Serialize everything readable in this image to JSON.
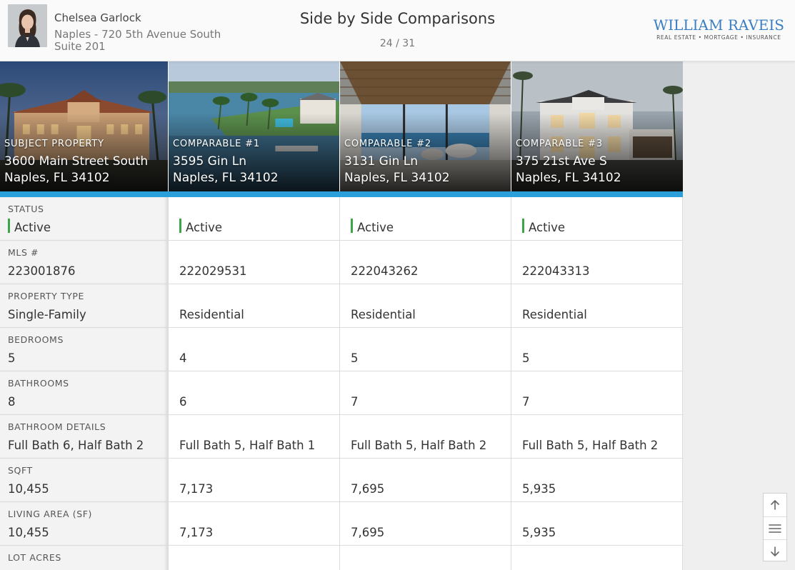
{
  "agent": {
    "name": "Chelsea Garlock",
    "office_line1": "Naples - 720 5th Avenue South",
    "office_line2": "Suite 201"
  },
  "page": {
    "title": "Side by Side Comparisons",
    "pager": "24 / 31"
  },
  "logo": {
    "main": "WILLIAM RAVEIS",
    "sub": "REAL ESTATE • MORTGAGE • INSURANCE"
  },
  "properties": [
    {
      "caption": "SUBJECT PROPERTY",
      "address_line1": "3600 Main Street South",
      "address_line2": "Naples, FL 34102"
    },
    {
      "caption": "COMPARABLE #1",
      "address_line1": "3595 Gin Ln",
      "address_line2": "Naples, FL 34102"
    },
    {
      "caption": "COMPARABLE #2",
      "address_line1": "3131 Gin Ln",
      "address_line2": "Naples, FL 34102"
    },
    {
      "caption": "COMPARABLE #3",
      "address_line1": "375 21st Ave S",
      "address_line2": "Naples, FL 34102"
    }
  ],
  "rows": [
    {
      "label": "STATUS",
      "values": [
        "Active",
        "Active",
        "Active",
        "Active"
      ]
    },
    {
      "label": "MLS #",
      "values": [
        "223001876",
        "222029531",
        "222043262",
        "222043313"
      ]
    },
    {
      "label": "PROPERTY TYPE",
      "values": [
        "Single-Family",
        "Residential",
        "Residential",
        "Residential"
      ]
    },
    {
      "label": "BEDROOMS",
      "values": [
        "5",
        "4",
        "5",
        "5"
      ]
    },
    {
      "label": "BATHROOMS",
      "values": [
        "8",
        "6",
        "7",
        "7"
      ]
    },
    {
      "label": "BATHROOM DETAILS",
      "values": [
        "Full Bath 6, Half Bath 2",
        "Full Bath 5, Half Bath 1",
        "Full Bath 5, Half Bath 2",
        "Full Bath 5, Half Bath 2"
      ]
    },
    {
      "label": "SQFT",
      "values": [
        "10,455",
        "7,173",
        "7,695",
        "5,935"
      ]
    },
    {
      "label": "LIVING AREA (SF)",
      "values": [
        "10,455",
        "7,173",
        "7,695",
        "5,935"
      ]
    },
    {
      "label": "LOT ACRES",
      "values": [
        "",
        "",
        "",
        ""
      ]
    }
  ],
  "colors": {
    "accent": "#2b9fd9",
    "status_active": "#3ba54a",
    "logo_blue": "#3a7ec4"
  },
  "icons": {
    "nav_up": "arrow-up-icon",
    "nav_menu": "menu-icon",
    "nav_down": "arrow-down-icon"
  }
}
